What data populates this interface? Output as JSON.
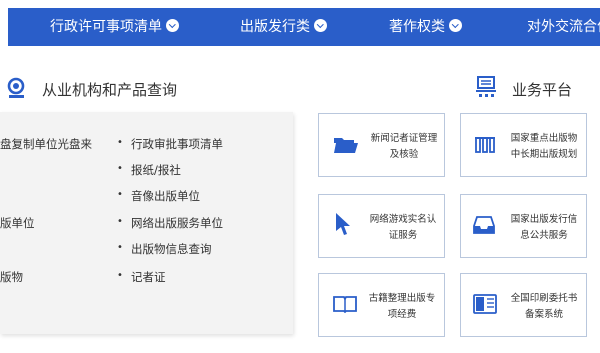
{
  "nav": {
    "items": [
      {
        "label": "行政许可事项清单"
      },
      {
        "label": "出版发行类"
      },
      {
        "label": "著作权类"
      },
      {
        "label": "对外交流合作"
      }
    ]
  },
  "left_section": {
    "title": "从业机构和产品查询",
    "icon": "search-icon",
    "left_column": [
      "盘复制单位光盘来",
      "版单位",
      "版物"
    ],
    "right_column": [
      "行政审批事项清单",
      "报纸/报社",
      "音像出版单位",
      "网络出版服务单位",
      "出版物信息查询",
      "记者证"
    ]
  },
  "right_section": {
    "title": "业务平台",
    "icon": "platform-icon",
    "cards": [
      {
        "line1": "新闻记者证管理",
        "line2": "及核验",
        "icon": "folder-icon"
      },
      {
        "line1": "国家重点出版物",
        "line2": "中长期出版规划",
        "icon": "books-icon"
      },
      {
        "line1": "网络游戏实名认",
        "line2": "证服务",
        "icon": "cursor-icon"
      },
      {
        "line1": "国家出版发行信",
        "line2": "息公共服务",
        "icon": "inbox-icon"
      },
      {
        "line1": "古籍整理出版专",
        "line2": "项经费",
        "icon": "open-book-icon"
      },
      {
        "line1": "全国印刷委托书",
        "line2": "备案系统",
        "icon": "printed-book-icon"
      }
    ]
  },
  "colors": {
    "accent": "#2a5ec9",
    "card_border": "#b9c7dd",
    "panel_bg": "#f3f3f3"
  }
}
